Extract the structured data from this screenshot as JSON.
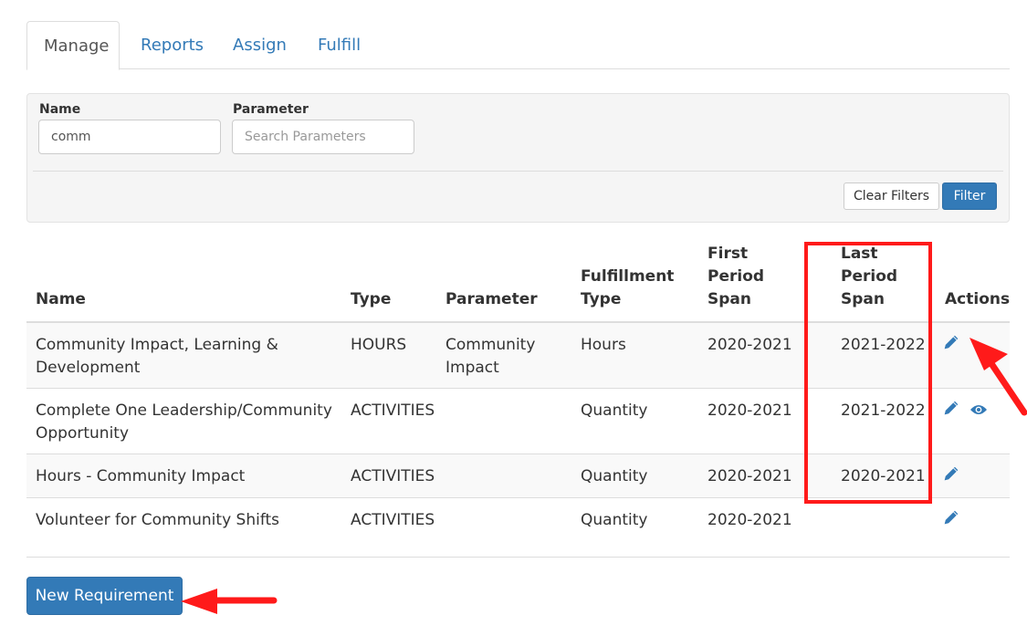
{
  "tabs": [
    {
      "label": "Manage",
      "active": true
    },
    {
      "label": "Reports",
      "active": false
    },
    {
      "label": "Assign",
      "active": false
    },
    {
      "label": "Fulfill",
      "active": false
    }
  ],
  "filters": {
    "name_label": "Name",
    "name_value": "comm",
    "parameter_label": "Parameter",
    "parameter_placeholder": "Search Parameters",
    "clear_label": "Clear Filters",
    "filter_label": "Filter"
  },
  "table": {
    "headers": {
      "name": "Name",
      "type": "Type",
      "parameter": "Parameter",
      "fulfillment_line1": "Fulfillment",
      "fulfillment_line2": "Type",
      "first_line1": "First Period",
      "first_line2": "Span",
      "last_line1": "Last Period",
      "last_line2": "Span",
      "actions": "Actions"
    },
    "rows": [
      {
        "name": "Community Impact, Learning & Development",
        "type": "HOURS",
        "parameter": "Community Impact",
        "fulfillment": "Hours",
        "first": "2020-2021",
        "last": "2021-2022",
        "actions": [
          "edit"
        ]
      },
      {
        "name": "Complete One Leadership/Community Opportunity",
        "type": "ACTIVITIES",
        "parameter": "",
        "fulfillment": "Quantity",
        "first": "2020-2021",
        "last": "2021-2022",
        "actions": [
          "edit",
          "view"
        ]
      },
      {
        "name": "Hours - Community Impact",
        "type": "ACTIVITIES",
        "parameter": "",
        "fulfillment": "Quantity",
        "first": "2020-2021",
        "last": "2020-2021",
        "actions": [
          "edit"
        ]
      },
      {
        "name": "Volunteer for Community Shifts",
        "type": "ACTIVITIES",
        "parameter": "",
        "fulfillment": "Quantity",
        "first": "2020-2021",
        "last": "",
        "actions": [
          "edit"
        ]
      }
    ]
  },
  "new_button_label": "New Requirement",
  "icons": {
    "edit": "pencil-icon",
    "view": "eye-icon"
  },
  "colors": {
    "primary": "#337ab7",
    "annotation": "#ff1a1a"
  }
}
